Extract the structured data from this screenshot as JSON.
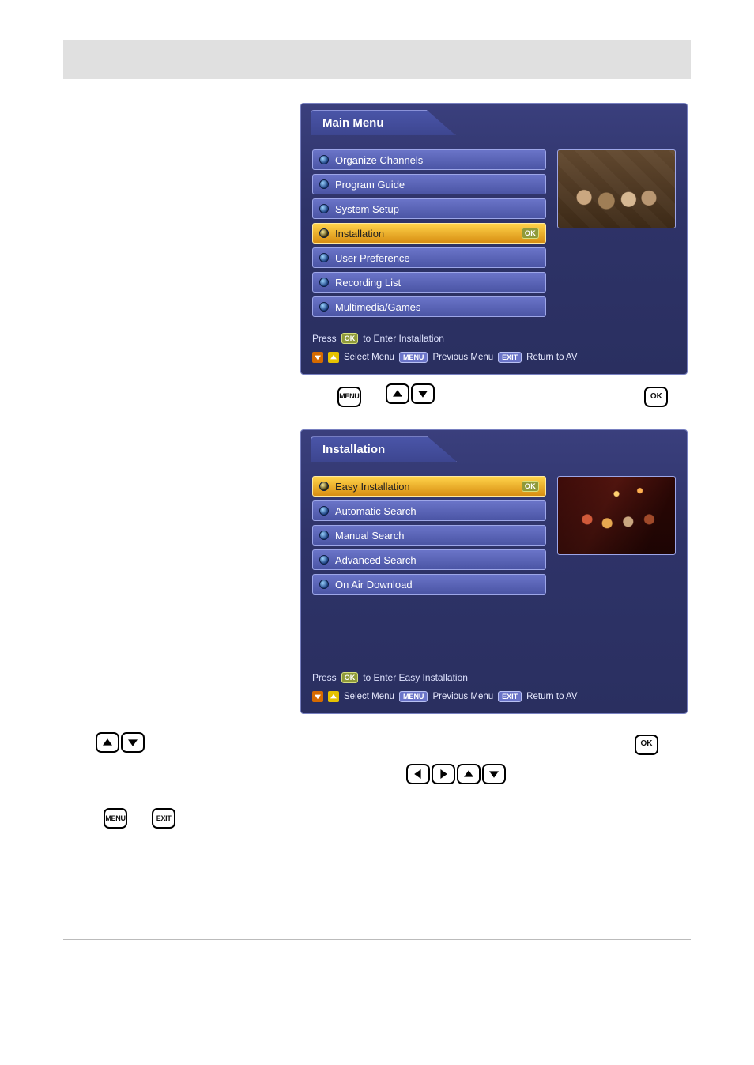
{
  "main_menu": {
    "title": "Main Menu",
    "items": [
      {
        "label": "Organize Channels"
      },
      {
        "label": "Program Guide"
      },
      {
        "label": "System Setup"
      },
      {
        "label": "Installation",
        "selected": true,
        "ok": true
      },
      {
        "label": "User Preference"
      },
      {
        "label": "Recording List"
      },
      {
        "label": "Multimedia/Games"
      }
    ],
    "hint_prefix": "Press",
    "hint_ok": "OK",
    "hint_suffix": "to Enter Installation",
    "legend": {
      "select": "Select Menu",
      "menu": "MENU",
      "prev": "Previous Menu",
      "exit": "EXIT",
      "return": "Return to AV"
    }
  },
  "installation": {
    "title": "Installation",
    "items": [
      {
        "label": "Easy Installation",
        "selected": true,
        "ok": true
      },
      {
        "label": "Automatic Search"
      },
      {
        "label": "Manual Search"
      },
      {
        "label": "Advanced Search"
      },
      {
        "label": "On Air Download"
      }
    ],
    "hint_prefix": "Press",
    "hint_ok": "OK",
    "hint_suffix": "to Enter Easy Installation",
    "legend": {
      "select": "Select Menu",
      "menu": "MENU",
      "prev": "Previous Menu",
      "exit": "EXIT",
      "return": "Return to AV"
    }
  },
  "keys": {
    "menu": "MENU",
    "ok": "OK",
    "exit": "EXIT"
  }
}
